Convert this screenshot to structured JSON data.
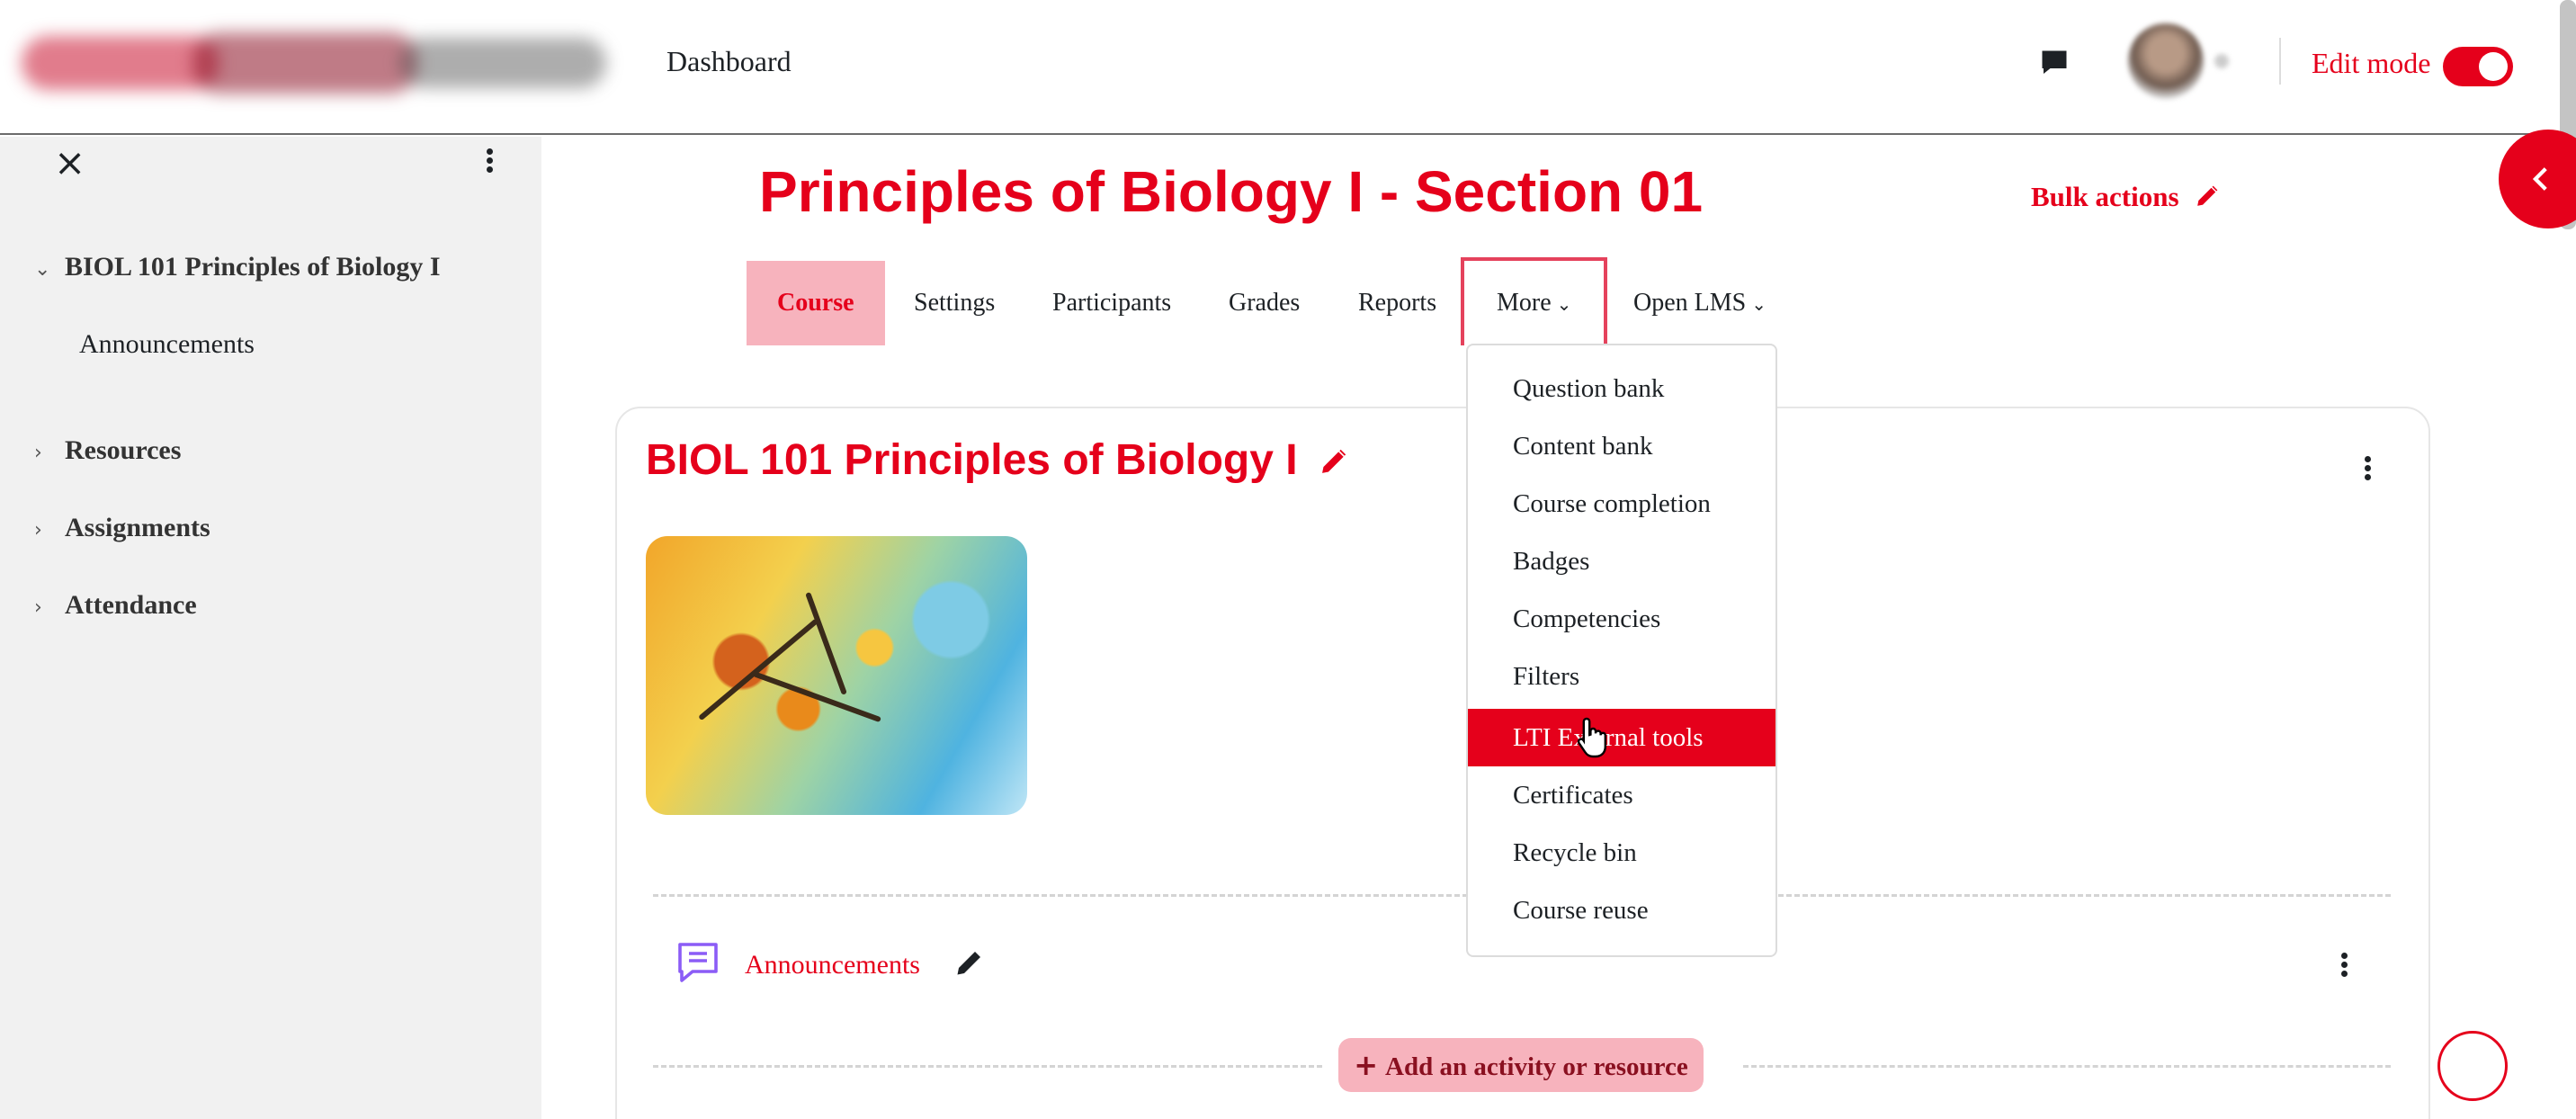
{
  "navbar": {
    "dashboard_label": "Dashboard",
    "edit_mode_label": "Edit mode",
    "edit_mode_on": true
  },
  "drawer": {
    "course_label": "BIOL 101 Principles of Biology I",
    "items": [
      {
        "label": "Announcements"
      },
      {
        "label": "Resources"
      },
      {
        "label": "Assignments"
      },
      {
        "label": "Attendance"
      }
    ]
  },
  "header": {
    "title": "Principles of Biology I - Section 01",
    "bulk_actions_label": "Bulk actions"
  },
  "tabs": [
    {
      "label": "Course",
      "active": true
    },
    {
      "label": "Settings"
    },
    {
      "label": "Participants"
    },
    {
      "label": "Grades"
    },
    {
      "label": "Reports"
    },
    {
      "label": "More",
      "open": true
    },
    {
      "label": "Open LMS"
    }
  ],
  "more_menu": {
    "items": [
      {
        "label": "Question bank"
      },
      {
        "label": "Content bank"
      },
      {
        "label": "Course completion"
      },
      {
        "label": "Badges"
      },
      {
        "label": "Competencies"
      },
      {
        "label": "Filters"
      },
      {
        "label": "LTI External tools",
        "highlighted": true
      },
      {
        "label": "Certificates"
      },
      {
        "label": "Recycle bin"
      },
      {
        "label": "Course reuse"
      }
    ]
  },
  "course": {
    "heading": "BIOL 101 Principles of Biology I",
    "activities": [
      {
        "label": "Announcements",
        "icon": "forum-icon"
      }
    ],
    "add_activity_label": "Add an activity or resource"
  },
  "colors": {
    "accent": "#e5001b",
    "accent_light": "#f7b3bd",
    "drawer_bg": "#f1f1f1"
  }
}
